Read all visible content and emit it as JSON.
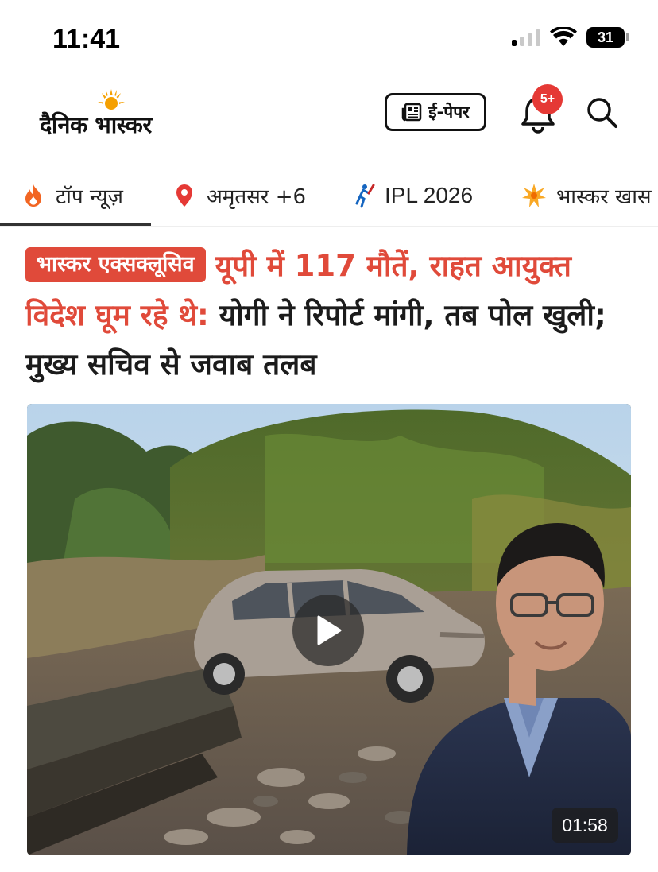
{
  "status_bar": {
    "time": "11:41",
    "battery_level": "31",
    "signal_bars_on": 1,
    "signal_bars_total": 4
  },
  "header": {
    "logo_text": "दैनिक भास्कर",
    "epaper_label": "ई-पेपर",
    "notification_count": "5+",
    "icons": [
      "newspaper-icon",
      "bell-icon",
      "search-icon"
    ]
  },
  "tabs": [
    {
      "label": "टॉप न्यूज़",
      "icon": "fire-icon",
      "active": true
    },
    {
      "label": "अमृतसर +6",
      "icon": "location-pin-icon",
      "active": false
    },
    {
      "label": "IPL 2026",
      "icon": "cricket-icon",
      "active": false
    },
    {
      "label": "भास्कर खास",
      "icon": "star-burst-icon",
      "active": false
    }
  ],
  "article": {
    "badge": "भास्कर एक्सक्लूसिव",
    "headline_red": "यूपी में 117 मौतें, राहत आयुक्त विदेश घूम रहे थे:",
    "headline_black": "योगी ने रिपोर्ट मांगी, तब पोल खुली; मुख्य सचिव से जवाब तलब",
    "video_duration": "01:58"
  },
  "colors": {
    "accent_red": "#e04a3a",
    "badge_red": "#e53935",
    "text_dark": "#1b1b1b"
  }
}
